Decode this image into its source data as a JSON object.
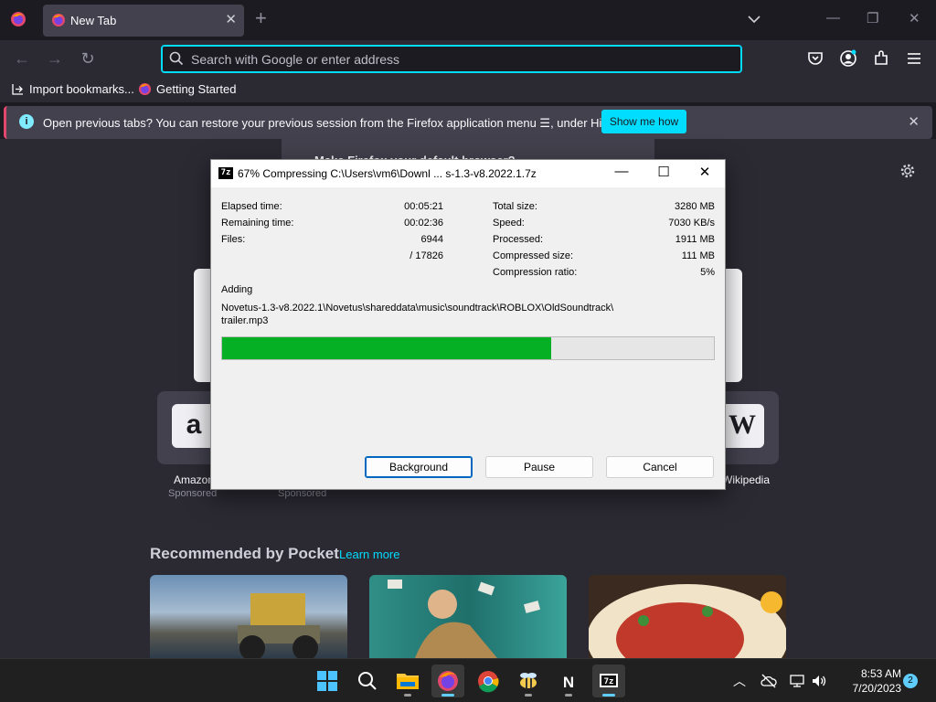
{
  "browser": {
    "tab": {
      "title": "New Tab",
      "close": "✕"
    },
    "new_tab": "+",
    "url_placeholder": "Search with Google or enter address",
    "bookmarks": [
      "Import bookmarks...",
      "Getting Started"
    ],
    "infobar": {
      "text": "Open previous tabs? You can restore your previous session from the Firefox application menu ☰, under History.",
      "button": "Show me how",
      "close": "✕"
    },
    "default_prompt": "Make Firefox your default browser?"
  },
  "newtab": {
    "top_sites": [
      {
        "label": "Amazon",
        "sponsor": "Sponsored",
        "logo": "a"
      },
      {
        "label": "",
        "sponsor": "Sponsored",
        "logo": ""
      },
      {
        "label": "Wikipedia",
        "sponsor": "",
        "logo": "W"
      }
    ],
    "pocket_title": "Recommended by Pocket",
    "pocket_learn": "Learn more"
  },
  "dialog": {
    "app_icon_text": "7z",
    "title": "67% Compressing C:\\Users\\vm6\\Downl ... s-1.3-v8.2022.1.7z",
    "left_stats": [
      {
        "label": "Elapsed time:",
        "value": "00:05:21"
      },
      {
        "label": "Remaining time:",
        "value": "00:02:36"
      },
      {
        "label": "Files:",
        "value": "6944"
      },
      {
        "label": "",
        "value": "/ 17826"
      }
    ],
    "right_stats": [
      {
        "label": "Total size:",
        "value": "3280 MB"
      },
      {
        "label": "Speed:",
        "value": "7030 KB/s"
      },
      {
        "label": "Processed:",
        "value": "1911 MB"
      },
      {
        "label": "Compressed size:",
        "value": "111 MB"
      },
      {
        "label": "Compression ratio:",
        "value": "5%"
      }
    ],
    "action": "Adding",
    "path_line1": "Novetus-1.3-v8.2022.1\\Novetus\\shareddata\\music\\soundtrack\\ROBLOX\\OldSoundtrack\\",
    "path_line2": "trailer.mp3",
    "progress_fraction": 0.67,
    "buttons": {
      "background": "Background",
      "pause": "Pause",
      "cancel": "Cancel"
    }
  },
  "taskbar": {
    "time": "8:53 AM",
    "date": "7/20/2023",
    "notifications": "2"
  },
  "colors": {
    "accent": "#00ddff",
    "progress": "#06b025",
    "win_accent": "#60cdff"
  }
}
